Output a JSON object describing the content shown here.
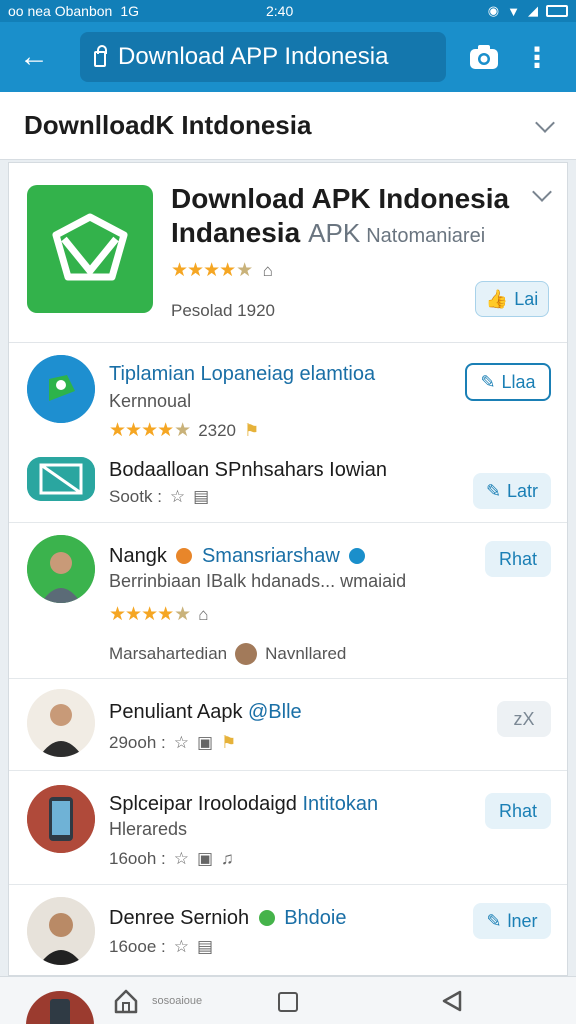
{
  "status_bar": {
    "carrier": "oo nea Obanbon",
    "network": "1G",
    "time": "2:40"
  },
  "url_bar": {
    "url": "Download APP Indonesia"
  },
  "page_header": {
    "title": "DownlloadK  Intdonesia"
  },
  "hero": {
    "title_line1": "Download APK Indonesia",
    "title_line2_strong": "Indanesia",
    "title_line2_apk": "APK",
    "title_line2_sub": "Natomaniarei",
    "meta": "Pesolad 1920",
    "button_label": "Lai",
    "rating_stars": 4.5
  },
  "items": [
    {
      "title": "Tiplamian Lopaneiag elamtioa",
      "subtitle": "Kernnoual",
      "meta": "2320",
      "button_label": "Llaa",
      "rating_stars": 4.5
    },
    {
      "title": "Bodaalloan SPnhsahars Iowian",
      "meta": "Sootk :",
      "button_label": "Latr"
    },
    {
      "title_prefix": "Nangk",
      "title_blue": "Smansriarshaw",
      "subtitle": "Berrinbiaan IBalk hdanads... wmaiaid",
      "meta": "Marsahartedian",
      "meta_right": "Navnllared",
      "button_label": "Rhat",
      "rating_stars": 4.5
    },
    {
      "title_prefix": "Penuliant Aapk",
      "title_blue": "@Blle",
      "meta": "29ooh :",
      "button_label": "zX"
    },
    {
      "title_prefix": "Splceipar Iroolodaigd",
      "title_blue": "Intitokan",
      "subtitle": "Hlerareds",
      "meta": "16ooh :",
      "button_label": "Rhat"
    },
    {
      "title_prefix": "Denree Sernioh",
      "title_blue": "Bhdoie",
      "meta": "16ooe :",
      "button_label": "lner"
    }
  ],
  "nav_bar": {
    "label": "sosoaioue"
  },
  "colors": {
    "accent": "#1a8fcb",
    "app_green": "#33b24b",
    "star": "#f5a623",
    "button_bg": "#e5f2f9"
  }
}
